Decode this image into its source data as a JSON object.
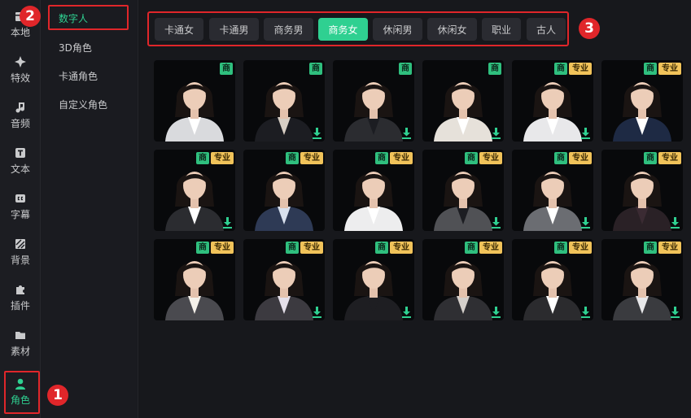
{
  "rail": {
    "items": [
      {
        "label": "本地",
        "icon": "box-icon"
      },
      {
        "label": "特效",
        "icon": "sparkle-icon"
      },
      {
        "label": "音频",
        "icon": "music-note-icon"
      },
      {
        "label": "文本",
        "icon": "text-t-icon"
      },
      {
        "label": "字幕",
        "icon": "cc-icon"
      },
      {
        "label": "背景",
        "icon": "stripes-icon"
      },
      {
        "label": "插件",
        "icon": "puzzle-icon"
      },
      {
        "label": "素材",
        "icon": "folder-icon"
      },
      {
        "label": "角色",
        "icon": "person-icon"
      }
    ],
    "active_index": 8
  },
  "submenu": {
    "items": [
      "数字人",
      "3D角色",
      "卡通角色",
      "自定义角色"
    ],
    "active_index": 0
  },
  "tags": {
    "items": [
      "卡通女",
      "卡通男",
      "商务男",
      "商务女",
      "休闲男",
      "休闲女",
      "职业",
      "古人"
    ],
    "active_index": 3
  },
  "badges": {
    "one": "1",
    "two": "2",
    "three": "3"
  },
  "cards": {
    "shang_label": "商",
    "pro_label": "专业",
    "flags": [
      {
        "pro": false,
        "download": false
      },
      {
        "pro": false,
        "download": true
      },
      {
        "pro": false,
        "download": true
      },
      {
        "pro": false,
        "download": true
      },
      {
        "pro": true,
        "download": true
      },
      {
        "pro": true,
        "download": false
      },
      {
        "pro": true,
        "download": true
      },
      {
        "pro": true,
        "download": false
      },
      {
        "pro": true,
        "download": false
      },
      {
        "pro": true,
        "download": true
      },
      {
        "pro": true,
        "download": true
      },
      {
        "pro": true,
        "download": true
      },
      {
        "pro": true,
        "download": false
      },
      {
        "pro": true,
        "download": true
      },
      {
        "pro": true,
        "download": true
      },
      {
        "pro": true,
        "download": true
      },
      {
        "pro": true,
        "download": true
      },
      {
        "pro": true,
        "download": true
      }
    ]
  },
  "colors": {
    "accent": "#2fd091",
    "highlight": "#e0262a",
    "chip_shang": "#2fbf7e",
    "chip_pro": "#f1c35a"
  }
}
